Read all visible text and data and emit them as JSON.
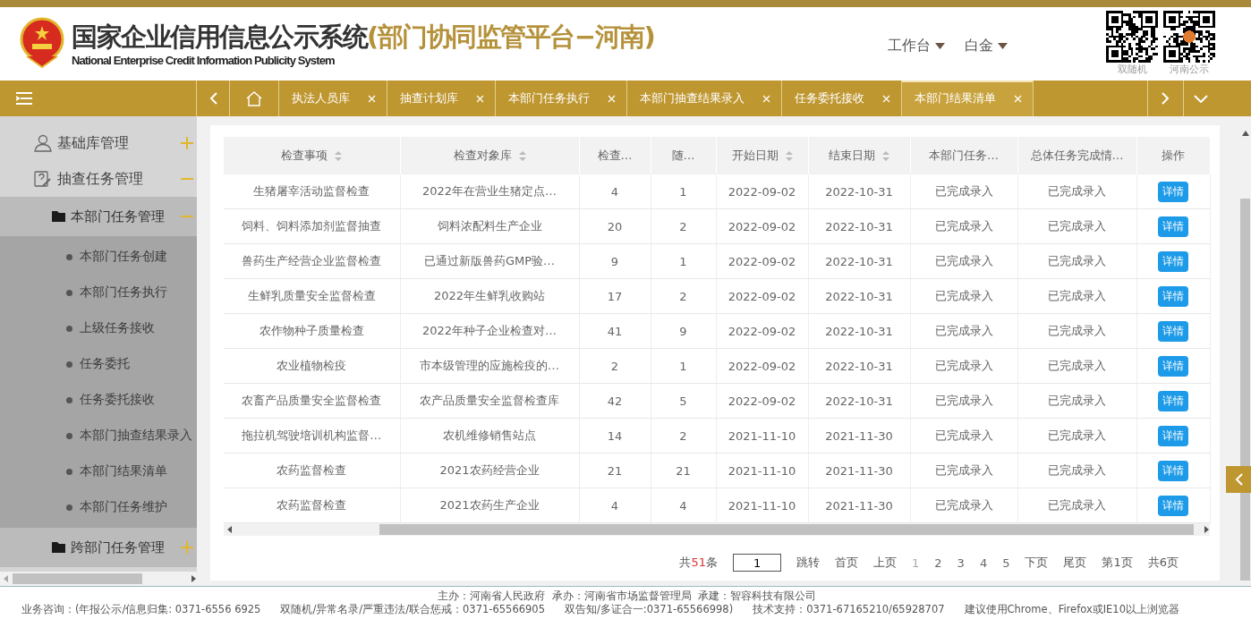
{
  "header": {
    "title": "国家企业信用信息公示系统",
    "subtitle": "(部门协同监管平台−河南)",
    "english_title": "National Enterprise Credit Information Publicity System",
    "menus": [
      "工作台",
      "白金"
    ],
    "qr_codes": [
      {
        "label": "双随机"
      },
      {
        "label": "河南公示"
      }
    ]
  },
  "nav": {
    "tabs": [
      {
        "label": "执法人员库",
        "selected": false
      },
      {
        "label": "抽查计划库",
        "selected": false
      },
      {
        "label": "本部门任务执行",
        "selected": false
      },
      {
        "label": "本部门抽查结果录入",
        "selected": false
      },
      {
        "label": "任务委托接收",
        "selected": false
      },
      {
        "label": "本部门结果清单",
        "selected": true
      }
    ]
  },
  "sidebar": {
    "items": [
      {
        "label": "基础库管理",
        "expanded": false
      },
      {
        "label": "抽查任务管理",
        "expanded": true,
        "children": [
          {
            "label": "本部门任务管理",
            "expanded": true,
            "children": [
              {
                "label": "本部门任务创建"
              },
              {
                "label": "本部门任务执行"
              },
              {
                "label": "上级任务接收"
              },
              {
                "label": "任务委托"
              },
              {
                "label": "任务委托接收"
              },
              {
                "label": "本部门抽查结果录入"
              },
              {
                "label": "本部门结果清单"
              },
              {
                "label": "本部门任务维护"
              }
            ]
          },
          {
            "label": "跨部门任务管理",
            "expanded": false
          }
        ]
      }
    ]
  },
  "table": {
    "columns": [
      {
        "label": "检查事项",
        "sortable": true
      },
      {
        "label": "检查对象库",
        "sortable": true
      },
      {
        "label": "检查…",
        "sortable": false
      },
      {
        "label": "随…",
        "sortable": false
      },
      {
        "label": "开始日期",
        "sortable": true
      },
      {
        "label": "结束日期",
        "sortable": true
      },
      {
        "label": "本部门任务…",
        "sortable": false
      },
      {
        "label": "总体任务完成情…",
        "sortable": false
      },
      {
        "label": "操作",
        "sortable": false
      }
    ],
    "rows": [
      {
        "cells": [
          "生猪屠宰活动监督检查",
          "2022年在营业生猪定点…",
          "4",
          "1",
          "2022-09-02",
          "2022-10-31",
          "已完成录入",
          "已完成录入"
        ],
        "action": "详情"
      },
      {
        "cells": [
          "饲料、饲料添加剂监督抽查",
          "饲料浓配料生产企业",
          "20",
          "2",
          "2022-09-02",
          "2022-10-31",
          "已完成录入",
          "已完成录入"
        ],
        "action": "详情"
      },
      {
        "cells": [
          "兽药生产经营企业监督检查",
          "已通过新版兽药GMP验…",
          "9",
          "1",
          "2022-09-02",
          "2022-10-31",
          "已完成录入",
          "已完成录入"
        ],
        "action": "详情"
      },
      {
        "cells": [
          "生鲜乳质量安全监督检查",
          "2022年生鲜乳收购站",
          "17",
          "2",
          "2022-09-02",
          "2022-10-31",
          "已完成录入",
          "已完成录入"
        ],
        "action": "详情"
      },
      {
        "cells": [
          "农作物种子质量检查",
          "2022年种子企业检查对…",
          "41",
          "9",
          "2022-09-02",
          "2022-10-31",
          "已完成录入",
          "已完成录入"
        ],
        "action": "详情"
      },
      {
        "cells": [
          "农业植物检疫",
          "市本级管理的应施检疫的…",
          "2",
          "1",
          "2022-09-02",
          "2022-10-31",
          "已完成录入",
          "已完成录入"
        ],
        "action": "详情"
      },
      {
        "cells": [
          "农畜产品质量安全监督检查",
          "农产品质量安全监督检查库",
          "42",
          "5",
          "2022-09-02",
          "2022-10-31",
          "已完成录入",
          "已完成录入"
        ],
        "action": "详情"
      },
      {
        "cells": [
          "拖拉机驾驶培训机构监督…",
          "农机维修销售站点",
          "14",
          "2",
          "2021-11-10",
          "2021-11-30",
          "已完成录入",
          "已完成录入"
        ],
        "action": "详情"
      },
      {
        "cells": [
          "农药监督检查",
          "2021农药经营企业",
          "21",
          "21",
          "2021-11-10",
          "2021-11-30",
          "已完成录入",
          "已完成录入"
        ],
        "action": "详情"
      },
      {
        "cells": [
          "农药监督检查",
          "2021农药生产企业",
          "4",
          "4",
          "2021-11-10",
          "2021-11-30",
          "已完成录入",
          "已完成录入"
        ],
        "action": "详情"
      }
    ]
  },
  "pagination": {
    "total_prefix": "共",
    "total_count": "51",
    "total_suffix": "条",
    "page_input": "1",
    "jump": "跳转",
    "first": "首页",
    "prev": "上页",
    "pages": [
      {
        "label": "1",
        "selected": true
      },
      {
        "label": "2",
        "selected": false
      },
      {
        "label": "3",
        "selected": false
      },
      {
        "label": "4",
        "selected": false
      },
      {
        "label": "5",
        "selected": false
      }
    ],
    "next": "下页",
    "last": "尾页",
    "current": "第1页",
    "total_pages": "共6页"
  },
  "footer": {
    "line1": "主办：河南省人民政府  承办：河南省市场监督管理局  承建：智容科技有限公司",
    "line2": [
      "业务咨询：(年报公示/信息归集: 0371-6556 6925",
      "双随机/异常名录/严重违法/联合惩戒：0371-65566905",
      "双告知/多证合一:0371-65566998)",
      "技术支持：0371-67165210/65928707",
      "建议使用Chrome、Firefox或IE10以上浏览器"
    ]
  }
}
